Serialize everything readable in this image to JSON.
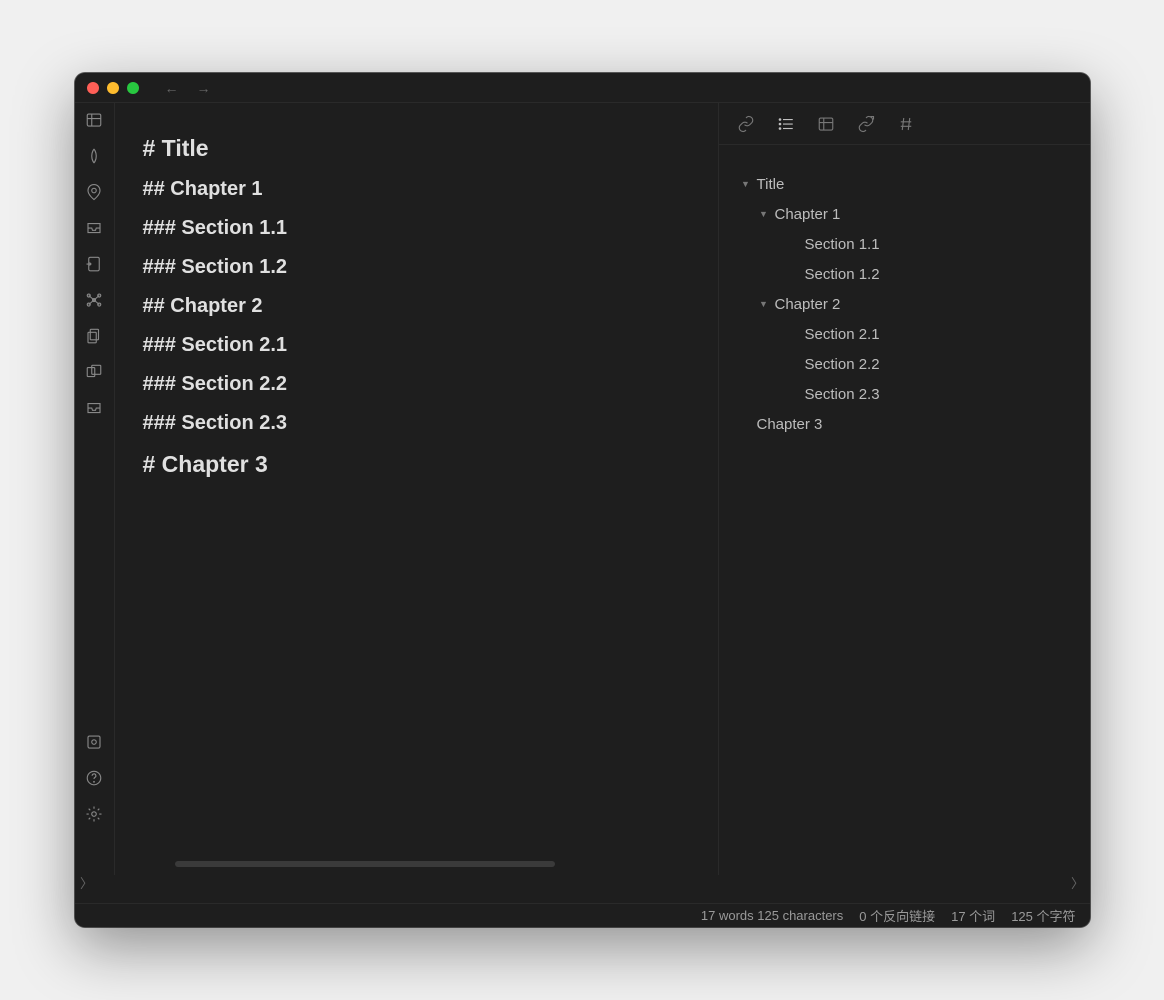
{
  "editor": {
    "lines": [
      {
        "level": 1,
        "text": "# Title"
      },
      {
        "level": 2,
        "text": "## Chapter 1"
      },
      {
        "level": 3,
        "text": "### Section 1.1"
      },
      {
        "level": 3,
        "text": "### Section 1.2"
      },
      {
        "level": 2,
        "text": "## Chapter 2"
      },
      {
        "level": 3,
        "text": "### Section 2.1"
      },
      {
        "level": 3,
        "text": "### Section 2.2"
      },
      {
        "level": 3,
        "text": "### Section 2.3"
      },
      {
        "level": 1,
        "text": "# Chapter 3"
      }
    ]
  },
  "outline": {
    "items": [
      {
        "level": 1,
        "label": "Title",
        "hasChildren": true
      },
      {
        "level": 2,
        "label": "Chapter 1",
        "hasChildren": true
      },
      {
        "level": 3,
        "label": "Section 1.1",
        "hasChildren": false
      },
      {
        "level": 3,
        "label": "Section 1.2",
        "hasChildren": false
      },
      {
        "level": 2,
        "label": "Chapter 2",
        "hasChildren": true
      },
      {
        "level": 3,
        "label": "Section 2.1",
        "hasChildren": false
      },
      {
        "level": 3,
        "label": "Section 2.2",
        "hasChildren": false
      },
      {
        "level": 3,
        "label": "Section 2.3",
        "hasChildren": false
      },
      {
        "level": 1,
        "label": "Chapter 3",
        "hasChildren": false
      }
    ]
  },
  "status": {
    "words_chars": "17 words 125 characters",
    "backlinks": "0 个反向链接",
    "words_cn": "17 个词",
    "chars_cn": "125 个字符"
  }
}
